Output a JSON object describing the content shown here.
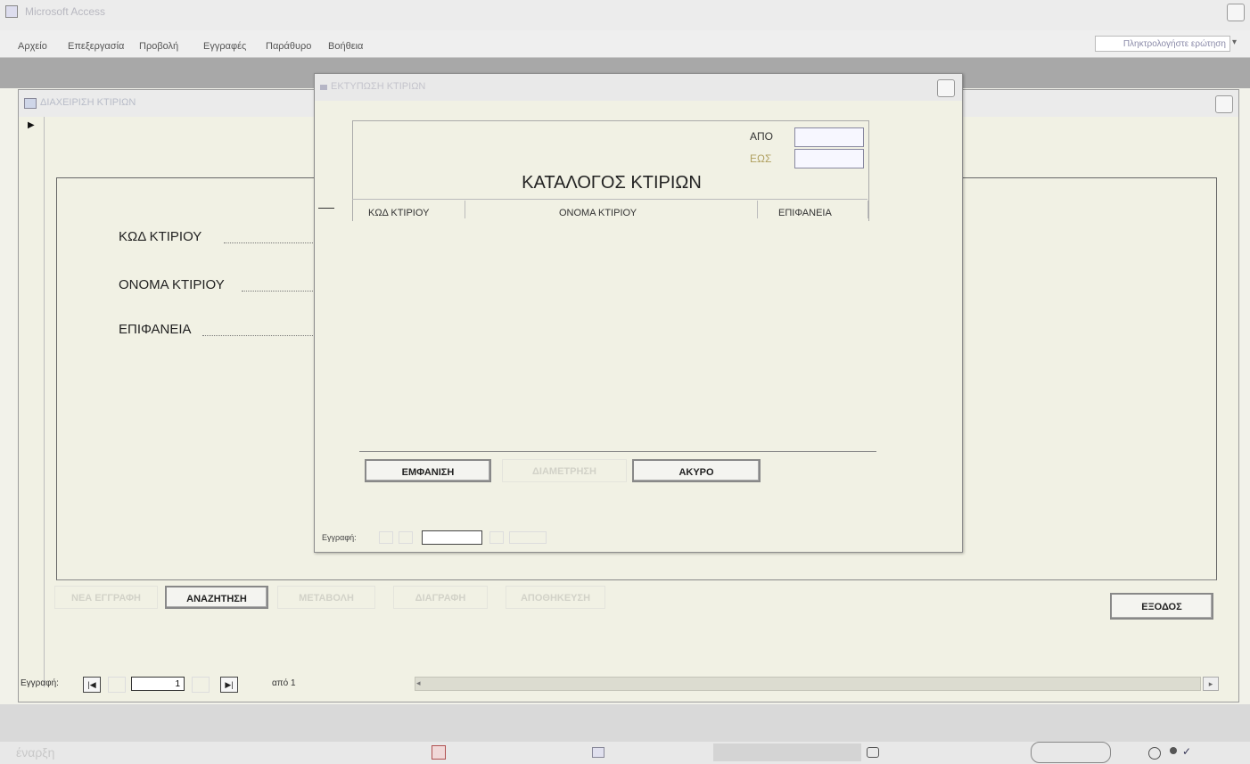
{
  "app": {
    "title": "Microsoft Access",
    "menu": [
      "Αρχείο",
      "Επεξεργασία",
      "Προβολή",
      "Εγγραφές",
      "Παράθυρο",
      "Βοήθεια"
    ],
    "help_search_placeholder": "Πληκτρολογήστε ερώτηση"
  },
  "main_form": {
    "title": "ΔΙΑΧΕΙΡΙΣΗ ΚΤΙΡΙΩΝ",
    "fields": [
      "ΚΩΔ ΚΤΙΡΙΟΥ",
      "ΟΝΟΜΑ ΚΤΙΡΙΟΥ",
      "ΕΠΙΦΑΝΕΙΑ"
    ],
    "buttons": {
      "new": "ΝΕΑ ΕΓΓΡΑΦΗ",
      "search": "ΑΝΑΖΗΤΗΣΗ",
      "edit": "ΜΕΤΑΒΟΛΗ",
      "delete": "ΔΙΑΓΡΑΦΗ",
      "save": "ΑΠΟΘΗΚΕΥΣΗ",
      "exit": "ΕΞΟΔΟΣ"
    },
    "nav": {
      "label": "Εγγραφή:",
      "current": "1",
      "of_label": "από 1"
    }
  },
  "dialog": {
    "title": "ΕΚΤΥΠΩΣΗ ΚΤΙΡΙΩΝ",
    "from_label": "ΑΠΟ",
    "to_label": "ΕΩΣ",
    "from_value": "",
    "to_value": "",
    "report_title": "ΚΑΤΑΛΟΓΟΣ ΚΤΙΡΙΩΝ",
    "columns": [
      "ΚΩΔ ΚΤΙΡΙΟΥ",
      "ΟΝΟΜΑ ΚΤΙΡΙΟΥ",
      "ΕΠΙΦΑΝΕΙΑ"
    ],
    "buttons": {
      "show": "ΕΜΦΑΝΙΣΗ",
      "print": "ΔΙΑΜΕΤΡΗΣΗ",
      "cancel": "ΑΚΥΡΟ"
    },
    "nav_label": "Εγγραφή:"
  },
  "taskbar": {
    "start_label": "έναρξη"
  }
}
